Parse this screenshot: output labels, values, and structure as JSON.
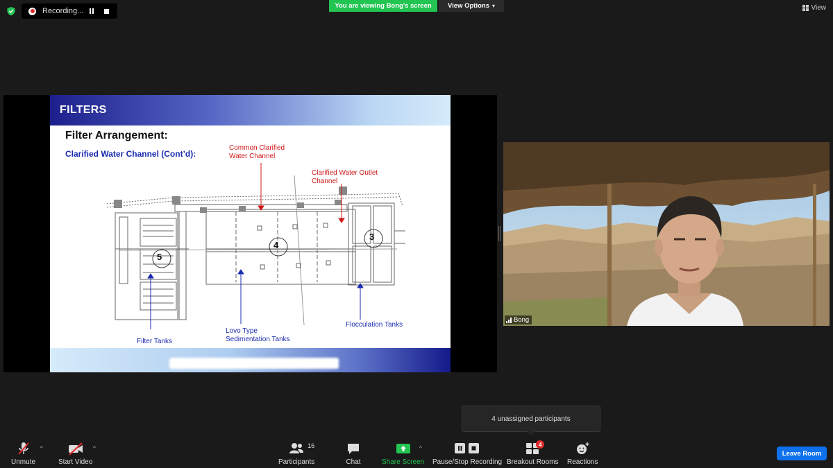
{
  "top_bar": {
    "recording_label": "Recording...",
    "viewing_banner": "You are viewing Bong's screen",
    "view_options_label": "View Options",
    "view_label": "View"
  },
  "slide": {
    "title": "FILTERS",
    "heading": "Filter Arrangement:",
    "subheading": "Clarified Water Channel (Cont’d):",
    "labels": {
      "common_channel_1": "Common Clarified",
      "common_channel_2": "Water Channel",
      "outlet_channel_1": "Clarified Water Outlet",
      "outlet_channel_2": "Channel",
      "filter_tanks": "Filter Tanks",
      "lovo_1": "Lovo Type",
      "lovo_2": "Sedimentation Tanks",
      "flocculation": "Flocculation Tanks"
    },
    "markers": {
      "five": "5",
      "four": "4",
      "three": "3"
    }
  },
  "video": {
    "participant_name": "Bong"
  },
  "tooltip": {
    "text": "4 unassigned participants"
  },
  "toolbar": {
    "unmute": "Unmute",
    "start_video": "Start Video",
    "participants": "Participants",
    "participant_count": "16",
    "chat": "Chat",
    "share_screen": "Share Screen",
    "pause_stop_recording": "Pause/Stop Recording",
    "breakout_rooms": "Breakout Rooms",
    "breakout_badge": "4",
    "reactions": "Reactions",
    "leave_room": "Leave Room"
  },
  "colors": {
    "share_green": "#23c552",
    "leave_blue": "#0e71eb",
    "slide_navy": "#1c1f8c",
    "label_red": "#d01818",
    "label_blue": "#1a2bb0"
  },
  "icons": {
    "security": "shield-check-icon",
    "mic": "microphone-muted-icon",
    "video": "camera-off-icon",
    "participants": "people-icon",
    "chat": "chat-bubble-icon",
    "share": "share-up-arrow-icon",
    "recording": "pause-stop-icon",
    "breakout": "grid-icon",
    "reactions": "smile-plus-icon"
  }
}
